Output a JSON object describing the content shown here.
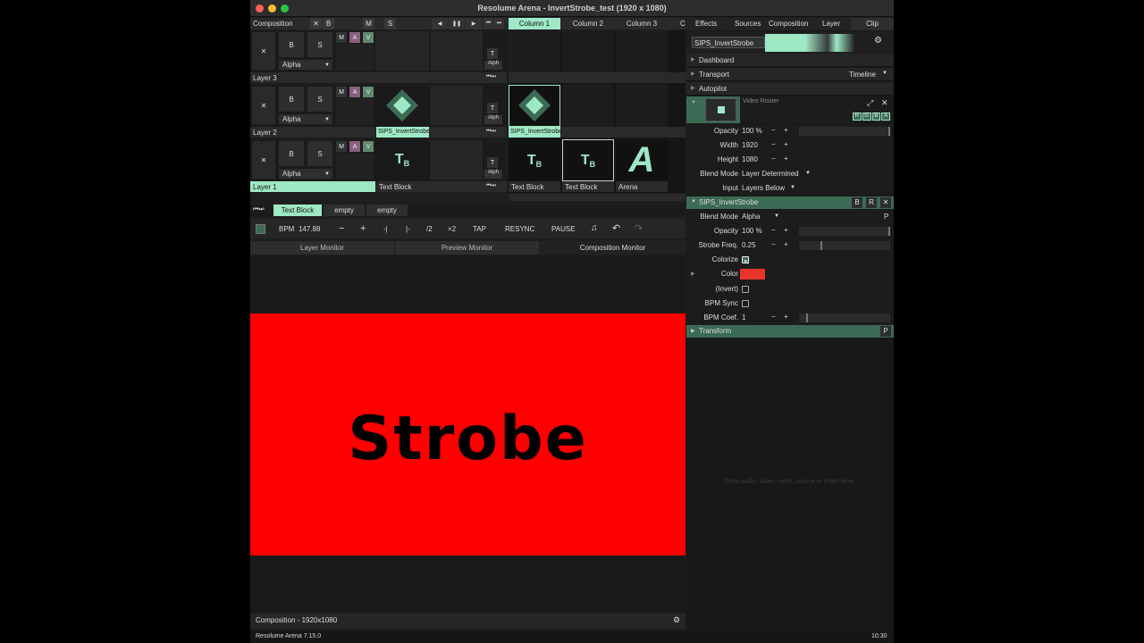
{
  "window": {
    "title": "Resolume Arena - InvertStrobe_test (1920 x 1080)"
  },
  "composition": {
    "label": "Composition",
    "x": "✕",
    "b": "B",
    "m": "M",
    "s": "S"
  },
  "columns": [
    "Column 1",
    "Column 2",
    "Column 3",
    "C"
  ],
  "layers": [
    {
      "name": "Layer 3",
      "blend": "Alpha",
      "clip": "",
      "active": false
    },
    {
      "name": "Layer 2",
      "blend": "Alpha",
      "clip": "SIPS_InvertStrobe",
      "active": false
    },
    {
      "name": "Layer 1",
      "blend": "Alpha",
      "clip": "Text Block",
      "active": true
    }
  ],
  "layer_buttons": {
    "x": "✕",
    "b": "B",
    "s": "S",
    "m": "M",
    "a": "A",
    "v": "V",
    "t": "T",
    "alph": "Alph"
  },
  "clips": {
    "layer2_col1": "SIPS_InvertStrobe",
    "layer1_col1": "Text Block",
    "layer1_col2": "Text Block",
    "layer1_col3": "Arena"
  },
  "deck": {
    "tabs": [
      "Text Block",
      "empty",
      "empty"
    ]
  },
  "transport": {
    "bpm_label": "BPM",
    "bpm": "147.88",
    "minus": "−",
    "plus": "+",
    "nudge_back": "-|",
    "nudge_fwd": "|-",
    "div2": "/2",
    "x2": "×2",
    "tap": "TAP",
    "resync": "RESYNC",
    "pause": "PAUSE"
  },
  "monitors": {
    "tabs": [
      "Layer Monitor",
      "Preview Monitor",
      "Composition Monitor"
    ],
    "text": "Strobe",
    "footer": "Composition - 1920x1080"
  },
  "status": {
    "version": "Resolume Arena 7.15.0",
    "time": "10:30"
  },
  "panel": {
    "tabs": [
      "Effects",
      "Sources",
      "Composition",
      "Layer",
      "Clip"
    ],
    "clip_name": "SIPS_InvertStrobe",
    "sections": {
      "dashboard": "Dashboard",
      "transport": "Transport",
      "transport_value": "Timeline",
      "autopilot": "Autopilot",
      "transform": "Transform"
    },
    "video_router": {
      "label": "Video Router",
      "rgba": [
        "R",
        "G",
        "B",
        "A"
      ]
    },
    "video_params": [
      {
        "label": "Opacity",
        "value": "100 %"
      },
      {
        "label": "Width",
        "value": "1920"
      },
      {
        "label": "Height",
        "value": "1080"
      },
      {
        "label": "Blend Mode",
        "value": "Layer Determined"
      },
      {
        "label": "Input",
        "value": "Layers Below"
      }
    ],
    "effect": {
      "name": "SIPS_InvertStrobe",
      "b": "B",
      "r": "R",
      "x": "✕",
      "p": "P"
    },
    "effect_params": {
      "blend_label": "Blend Mode",
      "blend_value": "Alpha",
      "opacity_label": "Opacity",
      "opacity_value": "100 %",
      "strobe_label": "Strobe Freq.",
      "strobe_value": "0.25",
      "colorize_label": "Colorize",
      "color_label": "Color",
      "color_value": "#e8352c",
      "invert_label": "(Invert)",
      "bpmsync_label": "BPM Sync",
      "bpmcoef_label": "BPM Coef.",
      "bpmcoef_value": "1"
    },
    "drop_hint": "Drop audio, video, mask, source or effect here."
  },
  "colors": {
    "accent": "#9ee8c6",
    "monitor_bg": "#ff0000",
    "effect_header": "#3c6b55"
  }
}
